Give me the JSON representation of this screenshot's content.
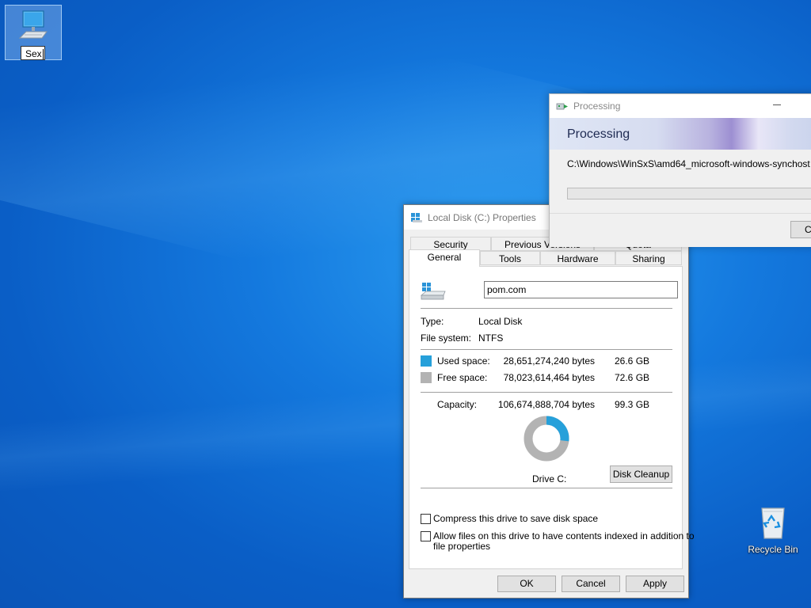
{
  "desktop": {
    "pc_icon_label": "Sex",
    "recycle_bin_label": "Recycle Bin"
  },
  "properties": {
    "title": "Local Disk (C:) Properties",
    "tabs_row1": [
      "Security",
      "Previous Versions",
      "Quota"
    ],
    "tabs_row2": [
      "General",
      "Tools",
      "Hardware",
      "Sharing"
    ],
    "active_tab": "General",
    "drive_label_value": "pom.com",
    "type_label": "Type:",
    "type_value": "Local Disk",
    "fs_label": "File system:",
    "fs_value": "NTFS",
    "used_label": "Used space:",
    "used_bytes": "28,651,274,240 bytes",
    "used_gb": "26.6 GB",
    "free_label": "Free space:",
    "free_bytes": "78,023,614,464 bytes",
    "free_gb": "72.6 GB",
    "capacity_label": "Capacity:",
    "capacity_bytes": "106,674,888,704 bytes",
    "capacity_gb": "99.3 GB",
    "drive_caption": "Drive C:",
    "disk_cleanup_label": "Disk Cleanup",
    "compress_label": "Compress this drive to save disk space",
    "index_label_line1": "Allow files on this drive to have contents indexed in addition to",
    "index_label_line2": "file properties",
    "ok_label": "OK",
    "cancel_label": "Cancel",
    "apply_label": "Apply",
    "used_fraction": 0.269,
    "used_color": "#26a0da",
    "free_color": "#b3b3b3"
  },
  "processing": {
    "window_title": "Processing",
    "heading": "Processing",
    "path": "C:\\Windows\\WinSxS\\amd64_microsoft-windows-synchost",
    "cancel_label_partial": "C"
  }
}
